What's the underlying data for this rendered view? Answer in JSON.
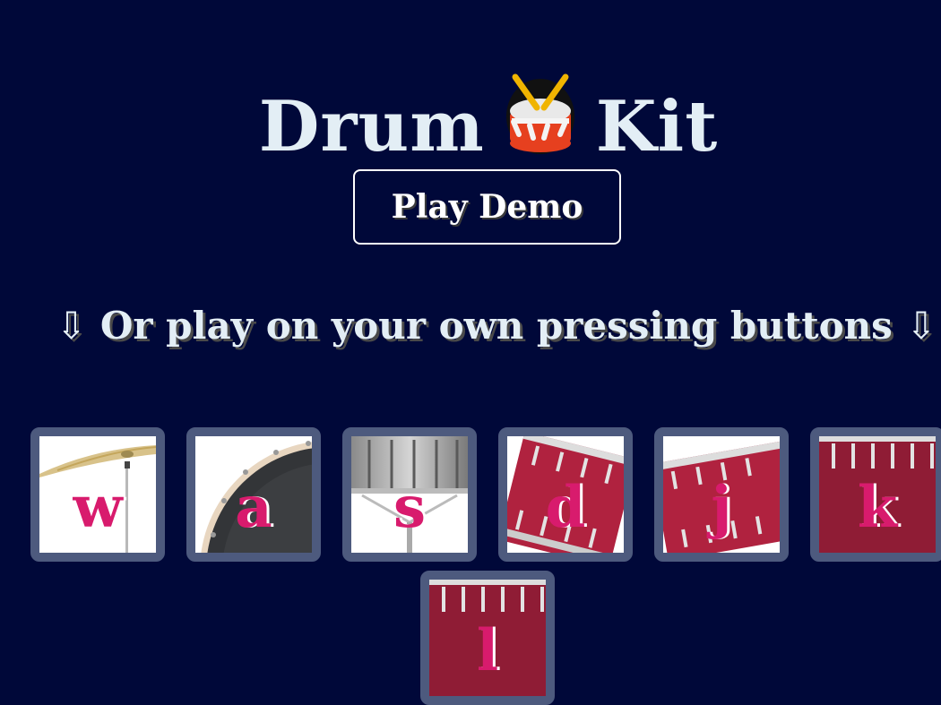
{
  "header": {
    "title_left": "Drum",
    "title_right": "Kit",
    "title_icon": "drum-emoji-icon"
  },
  "demo": {
    "button_label": "Play Demo"
  },
  "instruction": {
    "text": "⇩ Or play on your own pressing buttons ⇩"
  },
  "drums": [
    {
      "key": "w",
      "instrument": "crash-cymbal"
    },
    {
      "key": "a",
      "instrument": "kick-drum"
    },
    {
      "key": "s",
      "instrument": "snare-drum"
    },
    {
      "key": "d",
      "instrument": "tom-1"
    },
    {
      "key": "j",
      "instrument": "tom-2"
    },
    {
      "key": "k",
      "instrument": "tom-3"
    },
    {
      "key": "l",
      "instrument": "tom-4"
    }
  ],
  "colors": {
    "background": "#000839",
    "title_text": "#e3eef5",
    "key_letter": "#d81b6d",
    "key_border": "#4d5a7e",
    "drum_red": "#b0223f"
  }
}
